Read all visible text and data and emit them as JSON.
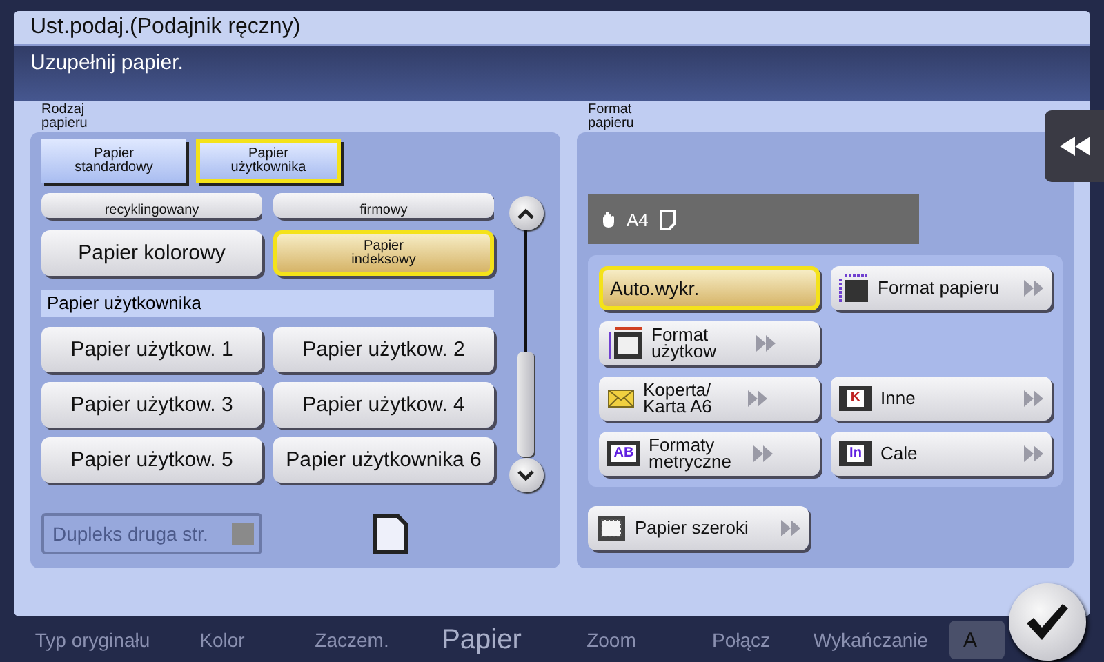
{
  "function_tabs": [
    {
      "label": "Typ oryginału",
      "selected": false
    },
    {
      "label": "Kolor",
      "selected": false
    },
    {
      "label": "Zaczem.",
      "selected": false
    },
    {
      "label": "Papier",
      "selected": true
    },
    {
      "label": "Zoom",
      "selected": false
    },
    {
      "label": "Połącz",
      "selected": false
    },
    {
      "label": "Wykańczanie",
      "selected": false
    }
  ],
  "apply_button": "A",
  "dialog": {
    "title": "Ust.podaj.(Podajnik ręczny)",
    "message": "Uzupełnij papier."
  },
  "paper_type": {
    "label": "Rodzaj papieru",
    "tabs": [
      {
        "label": "Papier standardowy",
        "selected": false
      },
      {
        "label": "Papier użytkownika",
        "selected": true
      }
    ],
    "items": [
      {
        "kind": "cut_button",
        "label": "recyklingowany",
        "selected": false,
        "compact": true
      },
      {
        "kind": "cut_button",
        "label": "firmowy",
        "selected": false,
        "compact": true
      },
      {
        "kind": "button",
        "label": "Papier kolorowy",
        "selected": false,
        "compact": false
      },
      {
        "kind": "button",
        "label": "Papier indeksowy",
        "selected": true,
        "compact": true
      },
      {
        "kind": "header",
        "label": "Papier użytkownika"
      },
      {
        "kind": "button",
        "label": "Papier użytkow. 1",
        "selected": false,
        "compact": false
      },
      {
        "kind": "button",
        "label": "Papier użytkow. 2",
        "selected": false,
        "compact": false
      },
      {
        "kind": "button",
        "label": "Papier użytkow. 3",
        "selected": false,
        "compact": false
      },
      {
        "kind": "button",
        "label": "Papier użytkow. 4",
        "selected": false,
        "compact": false
      },
      {
        "kind": "button",
        "label": "Papier użytkow. 5",
        "selected": false,
        "compact": false
      },
      {
        "kind": "button",
        "label": "Papier użytkownika 6",
        "selected": false,
        "compact": false
      }
    ],
    "duplex": {
      "label": "Dupleks druga str.",
      "disabled": true,
      "checked": false
    }
  },
  "paper_size": {
    "label": "Format papieru",
    "current": "A4",
    "rows": [
      [
        {
          "label": "Auto.wykr.",
          "selected": true,
          "kind": "plain"
        },
        {
          "label": "Format papieru",
          "selected": false,
          "kind": "question"
        }
      ],
      [
        {
          "label": "Format użytkow",
          "selected": false,
          "kind": "frame"
        }
      ],
      [
        {
          "label": "Koperta/ Karta A6",
          "selected": false,
          "kind": "envelope"
        },
        {
          "label": "Inne",
          "selected": false,
          "kind": "letter",
          "icon_text": "K"
        }
      ],
      [
        {
          "label": "Formaty metryczne",
          "selected": false,
          "kind": "letter",
          "icon_text": "AB"
        },
        {
          "label": "Cale",
          "selected": false,
          "kind": "letter",
          "icon_text": "In"
        }
      ]
    ],
    "wide": {
      "label": "Papier szeroki",
      "selected": false,
      "kind": "dashed"
    }
  }
}
